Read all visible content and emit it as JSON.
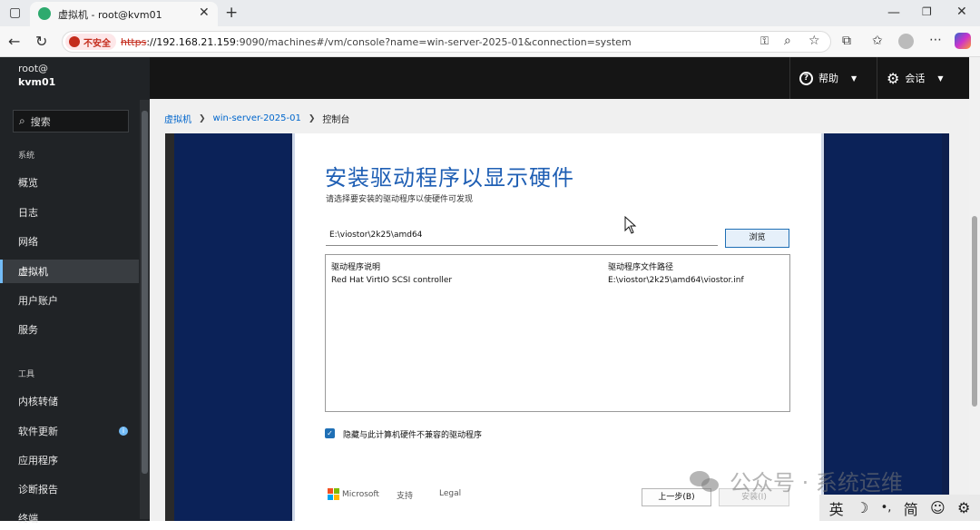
{
  "browser": {
    "tab_title": "虚拟机 - root@kvm01",
    "insecure_label": "不安全",
    "url_scheme": "https",
    "url_host": "://192.168.21.159",
    "url_rest": ":9090/machines#/vm/console?name=win-server-2025-01&connection=system"
  },
  "sidebar": {
    "user_line1": "root@",
    "user_line2": "kvm01",
    "search_label": "搜索",
    "section_system": "系统",
    "system_items": [
      {
        "label": "概览"
      },
      {
        "label": "日志"
      },
      {
        "label": "网络"
      },
      {
        "label": "虚拟机",
        "active": true
      },
      {
        "label": "用户账户"
      },
      {
        "label": "服务"
      }
    ],
    "section_tools": "工具",
    "tool_items": [
      {
        "label": "内核转储"
      },
      {
        "label": "软件更新",
        "badge": "i"
      },
      {
        "label": "应用程序"
      },
      {
        "label": "诊断报告"
      },
      {
        "label": "终端"
      }
    ]
  },
  "topbar": {
    "help_label": "帮助",
    "session_label": "会话"
  },
  "breadcrumb": {
    "item1": "虚拟机",
    "item2": "win-server-2025-01",
    "item3": "控制台"
  },
  "dialog": {
    "title": "安装驱动程序以显示硬件",
    "subtitle": "请选择要安装的驱动程序以使硬件可发现",
    "path_value": "E:\\viostor\\2k25\\amd64",
    "browse_label": "浏览",
    "table": {
      "headers": [
        "驱动程序说明",
        "驱动程序文件路径"
      ],
      "rows": [
        [
          "Red Hat VirtIO SCSI controller",
          "E:\\viostor\\2k25\\amd64\\viostor.inf"
        ]
      ]
    },
    "hide_incompatible_label": "隐藏与此计算机硬件不兼容的驱动程序",
    "hide_incompatible_checked": true,
    "brand": "Microsoft",
    "support_label": "支持",
    "legal_label": "Legal",
    "back_label": "上一步(B)",
    "install_label": "安装(I)"
  },
  "watermark": {
    "text": "公众号 · 系统运维"
  },
  "ime": {
    "lang": "英",
    "mode": "简"
  },
  "colors": {
    "accent": "#73bcf7",
    "dialog_title": "#1f5fb4",
    "desktop_blue": "#0b2258",
    "insecure_red": "#c42b1c"
  }
}
